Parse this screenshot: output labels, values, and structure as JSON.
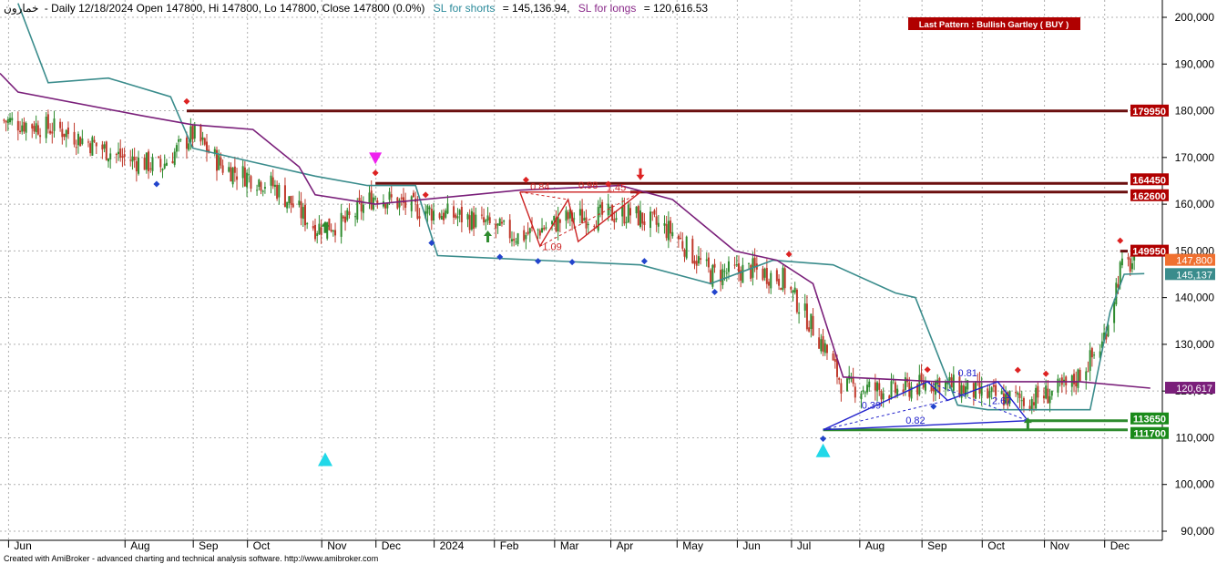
{
  "header": {
    "symbol": "خمارون",
    "info": "- Daily 12/18/2024 Open 147800, Hi 147800, Lo 147800, Close 147800 (0.0%)",
    "sl_shorts_label": "SL for shorts",
    "sl_shorts_value": "= 145,136.94,",
    "sl_longs_label": "SL for longs",
    "sl_longs_value": "= 120,616.53"
  },
  "pattern_label": "Last Pattern : Bullish Gartley ( BUY )",
  "footer": "Created with AmiBroker - advanced charting and technical analysis software. http://www.amibroker.com",
  "colors": {
    "bull": "#2e8b2e",
    "bear": "#c0392b",
    "teal_line": "#3a8c8c",
    "purple_line": "#7a1f7a",
    "resistance": "#6b0f0f",
    "support": "#2e8b2e",
    "pattern_red": "#cc2222",
    "pattern_blue": "#2222cc",
    "grid": "#b0b0b0"
  },
  "chart_data": {
    "type": "candlestick",
    "y_axis": {
      "ylim": [
        88000,
        203000
      ],
      "ticks": [
        "90,000",
        "100,000",
        "110,000",
        "120,000",
        "130,000",
        "140,000",
        "150,000",
        "160,000",
        "170,000",
        "180,000",
        "190,000",
        "200,000"
      ],
      "tick_values": [
        90000,
        100000,
        110000,
        120000,
        130000,
        140000,
        150000,
        160000,
        170000,
        180000,
        190000,
        200000
      ]
    },
    "x_axis": {
      "range": [
        "2023-06-01",
        "2024-12-31"
      ],
      "labels": [
        {
          "label": "Jun",
          "date": "2023-06-08"
        },
        {
          "label": "Aug",
          "date": "2023-08-05"
        },
        {
          "label": "Sep",
          "date": "2023-09-08"
        },
        {
          "label": "Oct",
          "date": "2023-10-05"
        },
        {
          "label": "Nov",
          "date": "2023-11-11"
        },
        {
          "label": "Dec",
          "date": "2023-12-08"
        },
        {
          "label": "2024",
          "date": "2024-01-06"
        },
        {
          "label": "Feb",
          "date": "2024-02-05"
        },
        {
          "label": "Mar",
          "date": "2024-03-06"
        },
        {
          "label": "Apr",
          "date": "2024-04-03"
        },
        {
          "label": "May",
          "date": "2024-05-06"
        },
        {
          "label": "Jun",
          "date": "2024-06-05"
        },
        {
          "label": "Jul",
          "date": "2024-07-02"
        },
        {
          "label": "Aug",
          "date": "2024-08-05"
        },
        {
          "label": "Sep",
          "date": "2024-09-05"
        },
        {
          "label": "Oct",
          "date": "2024-10-05"
        },
        {
          "label": "Nov",
          "date": "2024-11-05"
        },
        {
          "label": "Dec",
          "date": "2024-12-05"
        }
      ]
    },
    "price_path": [
      [
        "2023-06-01",
        178000
      ],
      [
        "2023-07-01",
        176000
      ],
      [
        "2023-08-01",
        170000
      ],
      [
        "2023-08-20",
        168000
      ],
      [
        "2023-09-05",
        175000
      ],
      [
        "2023-09-20",
        168000
      ],
      [
        "2023-10-15",
        164000
      ],
      [
        "2023-11-05",
        155000
      ],
      [
        "2023-11-20",
        156000
      ],
      [
        "2023-12-05",
        162000
      ],
      [
        "2023-12-25",
        159000
      ],
      [
        "2024-01-20",
        157000
      ],
      [
        "2024-02-15",
        153000
      ],
      [
        "2024-03-10",
        157000
      ],
      [
        "2024-04-10",
        158000
      ],
      [
        "2024-05-01",
        154000
      ],
      [
        "2024-05-20",
        145000
      ],
      [
        "2024-06-10",
        146000
      ],
      [
        "2024-06-25",
        144000
      ],
      [
        "2024-07-15",
        130000
      ],
      [
        "2024-07-25",
        121000
      ],
      [
        "2024-08-20",
        120000
      ],
      [
        "2024-09-10",
        122000
      ],
      [
        "2024-10-05",
        119000
      ],
      [
        "2024-10-25",
        118000
      ],
      [
        "2024-11-15",
        121000
      ],
      [
        "2024-12-01",
        130000
      ],
      [
        "2024-12-10",
        146000
      ],
      [
        "2024-12-18",
        147800
      ]
    ],
    "series": [
      {
        "name": "SL for shorts",
        "color": "#3a8c8c",
        "points": [
          [
            "2023-06-10",
            203000
          ],
          [
            "2023-06-25",
            186000
          ],
          [
            "2023-07-25",
            187000
          ],
          [
            "2023-08-25",
            183000
          ],
          [
            "2023-09-05",
            172000
          ],
          [
            "2023-10-05",
            169000
          ],
          [
            "2023-11-05",
            166000
          ],
          [
            "2023-12-01",
            164000
          ],
          [
            "2023-12-25",
            164000
          ],
          [
            "2024-01-05",
            149000
          ],
          [
            "2024-04-15",
            147000
          ],
          [
            "2024-05-20",
            143000
          ],
          [
            "2024-06-20",
            148000
          ],
          [
            "2024-07-20",
            147000
          ],
          [
            "2024-08-20",
            141000
          ],
          [
            "2024-08-30",
            140000
          ],
          [
            "2024-09-20",
            117000
          ],
          [
            "2024-10-05",
            116000
          ],
          [
            "2024-11-25",
            116000
          ],
          [
            "2024-12-05",
            137000
          ],
          [
            "2024-12-12",
            145000
          ],
          [
            "2024-12-22",
            145137
          ]
        ]
      },
      {
        "name": "SL for longs",
        "color": "#7a1f7a",
        "points": [
          [
            "2023-06-01",
            188000
          ],
          [
            "2023-06-10",
            184000
          ],
          [
            "2023-08-10",
            179000
          ],
          [
            "2023-09-05",
            177000
          ],
          [
            "2023-10-05",
            176000
          ],
          [
            "2023-10-28",
            168000
          ],
          [
            "2023-11-05",
            162000
          ],
          [
            "2023-12-05",
            160000
          ],
          [
            "2024-02-15",
            163000
          ],
          [
            "2024-04-05",
            164000
          ],
          [
            "2024-05-01",
            161000
          ],
          [
            "2024-06-01",
            150000
          ],
          [
            "2024-06-22",
            148000
          ],
          [
            "2024-07-10",
            143000
          ],
          [
            "2024-07-25",
            123000
          ],
          [
            "2024-09-10",
            122000
          ],
          [
            "2024-11-20",
            122000
          ],
          [
            "2024-12-25",
            120617
          ]
        ]
      }
    ],
    "horizontal_levels": [
      {
        "label": "179950",
        "value": 179950,
        "from": "2023-09-02",
        "color": "#6b0f0f",
        "type": "resistance"
      },
      {
        "label": "164450",
        "value": 164450,
        "from": "2023-12-05",
        "color": "#6b0f0f",
        "type": "resistance"
      },
      {
        "label": "162600",
        "value": 162600,
        "from": "2024-04-10",
        "color": "#6b0f0f",
        "type": "resistance"
      },
      {
        "label": "149950",
        "value": 149950,
        "from": "2024-12-10",
        "color": "#6b0f0f",
        "type": "resistance"
      },
      {
        "label": "113650",
        "value": 113650,
        "from": "2024-10-25",
        "color": "#2e8b2e",
        "type": "support"
      },
      {
        "label": "111700",
        "value": 111700,
        "from": "2024-07-15",
        "color": "#2e8b2e",
        "type": "support"
      }
    ],
    "price_tags": [
      {
        "label": "147,800",
        "value": 147800,
        "color": "#f07030"
      },
      {
        "label": "145,137",
        "value": 145137,
        "color": "#3a8c8c"
      },
      {
        "label": "120,617",
        "value": 120617,
        "color": "#7a1f7a"
      }
    ],
    "patterns": [
      {
        "color": "#cc2222",
        "points": [
          [
            "2024-02-15",
            162600
          ],
          [
            "2024-02-25",
            151000
          ],
          [
            "2024-03-10",
            161000
          ],
          [
            "2024-03-15",
            152000
          ],
          [
            "2024-04-15",
            162600
          ],
          [
            "2024-02-15",
            162600
          ]
        ],
        "labels": [
          {
            "text": "0.84",
            "date": "2024-02-25",
            "value": 163000
          },
          {
            "text": "0.98",
            "date": "2024-03-20",
            "value": 163300
          },
          {
            "text": "1.45",
            "date": "2024-04-03",
            "value": 162800
          },
          {
            "text": "1.09",
            "date": "2024-03-02",
            "value": 150200
          }
        ]
      },
      {
        "color": "#2222cc",
        "points": [
          [
            "2024-07-15",
            111700
          ],
          [
            "2024-09-05",
            122000
          ],
          [
            "2024-09-15",
            118000
          ],
          [
            "2024-10-10",
            122000
          ],
          [
            "2024-10-25",
            113650
          ],
          [
            "2024-07-15",
            111700
          ]
        ],
        "labels": [
          {
            "text": "0.81",
            "date": "2024-09-25",
            "value": 123200
          },
          {
            "text": "0.39",
            "date": "2024-08-08",
            "value": 116200
          },
          {
            "text": "2.67",
            "date": "2024-10-12",
            "value": 117200
          },
          {
            "text": "0.82",
            "date": "2024-08-30",
            "value": 113000
          }
        ]
      }
    ],
    "markers": [
      {
        "type": "diamond",
        "color": "#dd2222",
        "date": "2023-09-02",
        "value": 182000
      },
      {
        "type": "diamond",
        "color": "#2244cc",
        "date": "2023-08-18",
        "value": 164300
      },
      {
        "type": "diamond",
        "color": "#dd2222",
        "date": "2023-12-05",
        "value": 166700
      },
      {
        "type": "diamond",
        "color": "#dd2222",
        "date": "2023-12-30",
        "value": 162000
      },
      {
        "type": "diamond",
        "color": "#2244cc",
        "date": "2024-01-02",
        "value": 151700
      },
      {
        "type": "diamond",
        "color": "#2244cc",
        "date": "2024-02-05",
        "value": 148700
      },
      {
        "type": "diamond",
        "color": "#dd2222",
        "date": "2024-02-18",
        "value": 165200
      },
      {
        "type": "diamond",
        "color": "#2244cc",
        "date": "2024-02-24",
        "value": 147800
      },
      {
        "type": "diamond",
        "color": "#2244cc",
        "date": "2024-03-12",
        "value": 147600
      },
      {
        "type": "diamond",
        "color": "#dd2222",
        "date": "2024-03-30",
        "value": 164300
      },
      {
        "type": "diamond",
        "color": "#2244cc",
        "date": "2024-04-17",
        "value": 147800
      },
      {
        "type": "diamond",
        "color": "#2244cc",
        "date": "2024-05-22",
        "value": 141200
      },
      {
        "type": "diamond",
        "color": "#dd2222",
        "date": "2024-06-28",
        "value": 149300
      },
      {
        "type": "diamond",
        "color": "#2244cc",
        "date": "2024-07-15",
        "value": 109800
      },
      {
        "type": "diamond",
        "color": "#dd2222",
        "date": "2024-09-05",
        "value": 124600
      },
      {
        "type": "diamond",
        "color": "#2244cc",
        "date": "2024-09-08",
        "value": 116700
      },
      {
        "type": "diamond",
        "color": "#dd2222",
        "date": "2024-10-20",
        "value": 124500
      },
      {
        "type": "diamond",
        "color": "#dd2222",
        "date": "2024-11-03",
        "value": 123700
      },
      {
        "type": "diamond",
        "color": "#dd2222",
        "date": "2024-12-10",
        "value": 152200
      },
      {
        "type": "triangle-up",
        "color": "#22d8e8",
        "date": "2023-11-10",
        "value": 105300
      },
      {
        "type": "triangle-up",
        "color": "#22d8e8",
        "date": "2024-07-15",
        "value": 107200
      },
      {
        "type": "triangle-down",
        "color": "#ee22ee",
        "date": "2023-12-05",
        "value": 169700
      },
      {
        "type": "arrow-up",
        "color": "#2e8b2e",
        "date": "2023-11-10",
        "value": 155000
      },
      {
        "type": "arrow-up",
        "color": "#2e8b2e",
        "date": "2024-01-30",
        "value": 153000
      },
      {
        "type": "arrow-up",
        "color": "#2e8b2e",
        "date": "2024-10-25",
        "value": 113000
      },
      {
        "type": "arrow-down",
        "color": "#dd2222",
        "date": "2024-04-15",
        "value": 166500
      }
    ]
  }
}
